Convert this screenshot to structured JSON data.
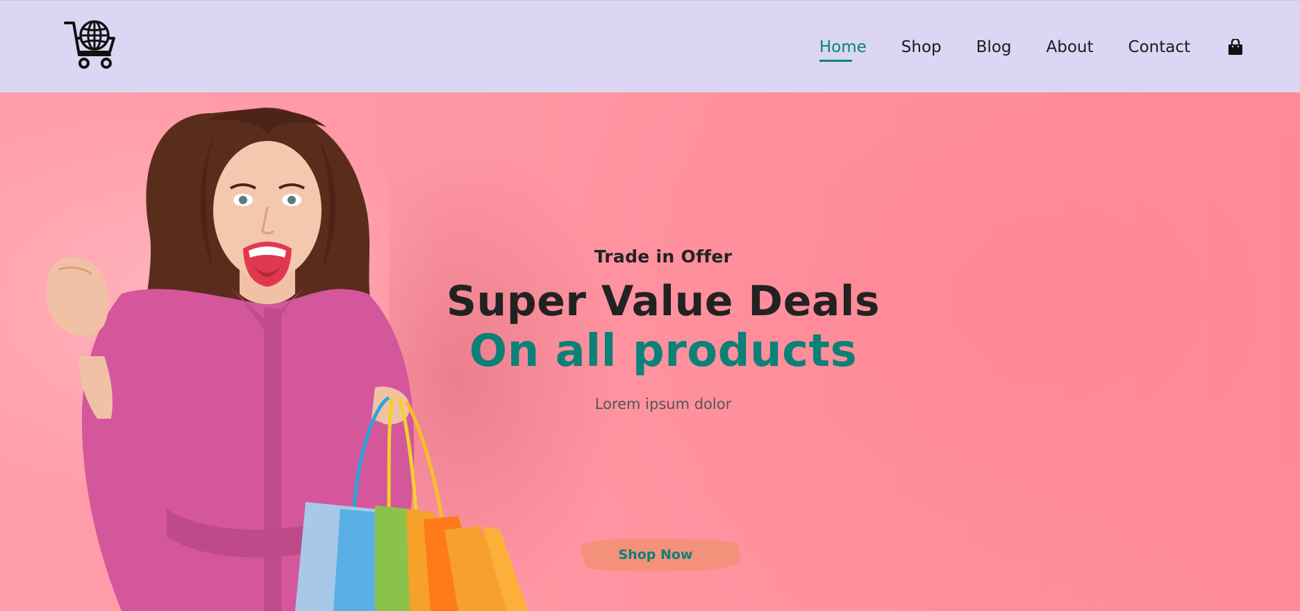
{
  "colors": {
    "header_bg": "#dad6f4",
    "accent": "#0b8178",
    "hero_bg": "#ff95a2",
    "button_bg": "#f4917a",
    "text_dark": "#222222"
  },
  "header": {
    "logo_icon": "globe-shopping-cart-icon",
    "nav": [
      {
        "label": "Home",
        "active": true
      },
      {
        "label": "Shop",
        "active": false
      },
      {
        "label": "Blog",
        "active": false
      },
      {
        "label": "About",
        "active": false
      },
      {
        "label": "Contact",
        "active": false
      }
    ],
    "cart_icon": "shopping-bag-icon"
  },
  "hero": {
    "kicker": "Trade in Offer",
    "headline": "Super Value Deals",
    "subheadline": "On all products",
    "tagline": "Lorem ipsum dolor",
    "cta_label": "Shop Now"
  }
}
